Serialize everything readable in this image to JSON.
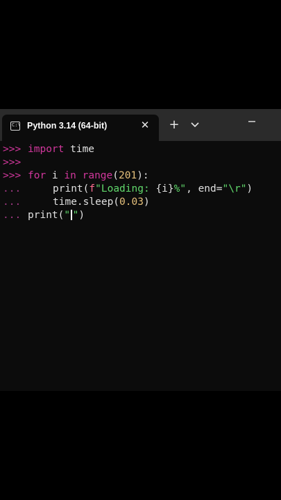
{
  "window": {
    "tab_title": "Python 3.14 (64-bit)",
    "tab_icon_glyph": "C:\\",
    "close_glyph": "✕",
    "new_tab_glyph": "+"
  },
  "console": {
    "prompt": ">>>",
    "continuation": "...",
    "lines": [
      {
        "type": "prompt",
        "segments": [
          {
            "cls": "kw",
            "text": "import"
          },
          {
            "cls": "plain",
            "text": " time"
          }
        ]
      },
      {
        "type": "prompt",
        "segments": []
      },
      {
        "type": "prompt",
        "segments": [
          {
            "cls": "kw",
            "text": "for"
          },
          {
            "cls": "plain",
            "text": " i "
          },
          {
            "cls": "kw",
            "text": "in"
          },
          {
            "cls": "plain",
            "text": " "
          },
          {
            "cls": "kw",
            "text": "range"
          },
          {
            "cls": "plain",
            "text": "("
          },
          {
            "cls": "num",
            "text": "201"
          },
          {
            "cls": "plain",
            "text": "):"
          }
        ]
      },
      {
        "type": "cont",
        "indent": true,
        "segments": [
          {
            "cls": "plain",
            "text": "print("
          },
          {
            "cls": "strf",
            "text": "f"
          },
          {
            "cls": "str",
            "text": "\"Loading: "
          },
          {
            "cls": "plain",
            "text": "{i}"
          },
          {
            "cls": "str",
            "text": "%\""
          },
          {
            "cls": "plain",
            "text": ", end="
          },
          {
            "cls": "str",
            "text": "\"\\r\""
          },
          {
            "cls": "plain",
            "text": ")"
          }
        ]
      },
      {
        "type": "cont",
        "indent": true,
        "segments": [
          {
            "cls": "plain",
            "text": "time.sleep("
          },
          {
            "cls": "num",
            "text": "0.03"
          },
          {
            "cls": "plain",
            "text": ")"
          }
        ]
      },
      {
        "type": "cont",
        "caret": true,
        "segments": [
          {
            "cls": "plain",
            "text": "print("
          },
          {
            "cls": "str",
            "text": "\""
          },
          {
            "cls": "caret",
            "text": ""
          },
          {
            "cls": "str",
            "text": "\""
          },
          {
            "cls": "plain",
            "text": ")"
          }
        ]
      }
    ]
  },
  "colors": {
    "titlebar": "#2b2b2b",
    "console_bg": "#0c0c0c",
    "keyword": "#d1379c",
    "string": "#61d96c",
    "number": "#e5c07b"
  },
  "icons": {
    "tab": "terminal-icon",
    "close": "close-icon",
    "new_tab": "plus-icon",
    "dropdown": "chevron-down-icon",
    "minimize": "minimize-icon"
  }
}
